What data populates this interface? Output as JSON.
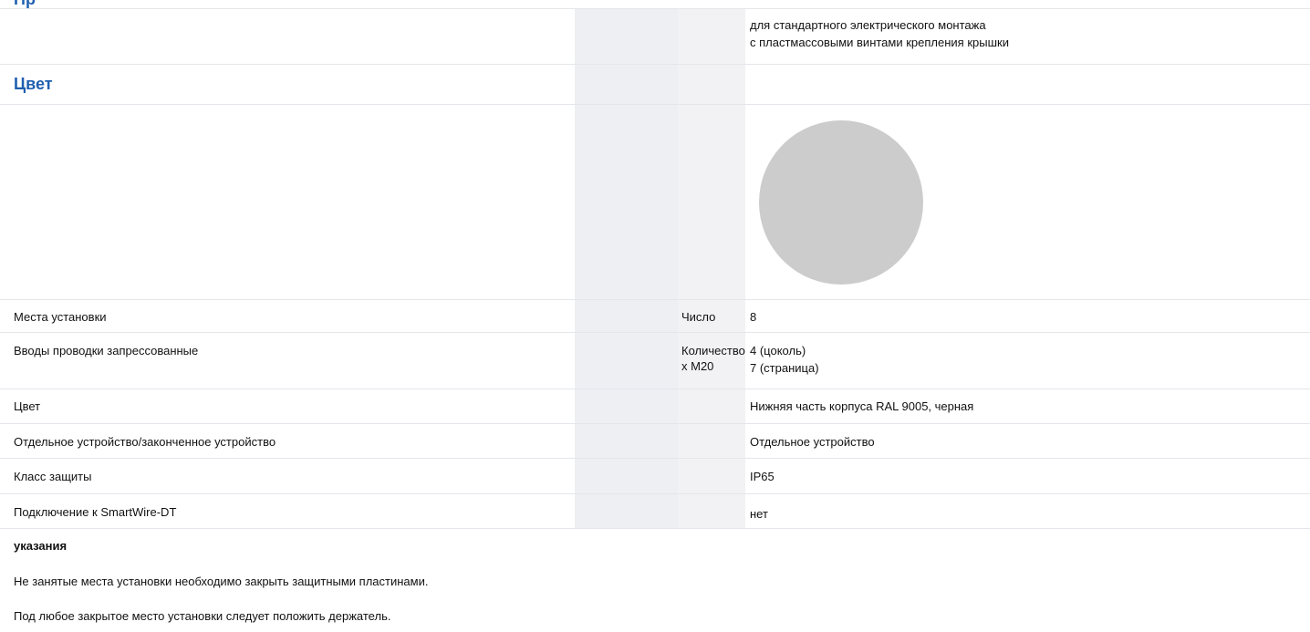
{
  "header_clip": "Пр",
  "description_lines": [
    "для стандартного электрического монтажа",
    "с пластмассовыми винтами крепления крышки"
  ],
  "color_section": {
    "title": "Цвет",
    "swatch_color": "#cccccc"
  },
  "rows": [
    {
      "label": "Места установки",
      "unit": "Число",
      "value": "8"
    },
    {
      "label": "Вводы проводки запрессованные",
      "unit": "Количество x M20",
      "value_lines": [
        "4 (цоколь)",
        "7 (страница)"
      ]
    },
    {
      "label": "Цвет",
      "unit": "",
      "value": "Нижняя часть корпуса RAL 9005, черная"
    },
    {
      "label": "Отдельное устройство/законченное устройство",
      "unit": "",
      "value": "Отдельное устройство"
    },
    {
      "label": "Класс защиты",
      "unit": "",
      "value": "IP65"
    },
    {
      "label": "Подключение к SmartWire-DT",
      "unit": "",
      "value": "нет"
    }
  ],
  "notes": {
    "title": "указания",
    "items": [
      "Не занятые места установки необходимо закрыть защитными пластинами.",
      "Под любое закрытое место установки следует положить держатель."
    ]
  },
  "colors": {
    "heading": "#1f5fb0",
    "column_shade": "#eeeff3",
    "divider": "#e4e6eb"
  }
}
